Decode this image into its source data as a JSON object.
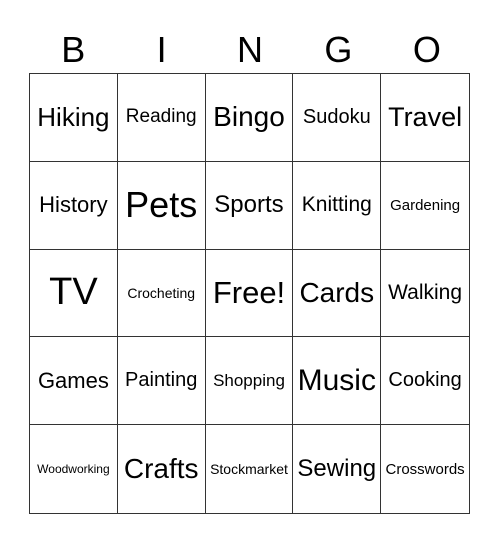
{
  "header": [
    "B",
    "I",
    "N",
    "G",
    "O"
  ],
  "cells": [
    "Hiking",
    "Reading",
    "Bingo",
    "Sudoku",
    "Travel",
    "History",
    "Pets",
    "Sports",
    "Knitting",
    "Gardening",
    "TV",
    "Crocheting",
    "Free!",
    "Cards",
    "Walking",
    "Games",
    "Painting",
    "Shopping",
    "Music",
    "Cooking",
    "Woodworking",
    "Crafts",
    "Stockmarket",
    "Sewing",
    "Crosswords"
  ]
}
